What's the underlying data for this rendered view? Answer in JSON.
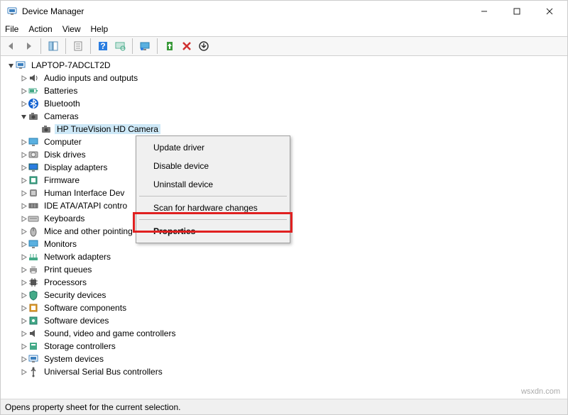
{
  "window": {
    "title": "Device Manager"
  },
  "menubar": [
    "File",
    "Action",
    "View",
    "Help"
  ],
  "toolbar_icons": [
    "nav-back",
    "nav-forward",
    "show-hide-tree",
    "properties",
    "help",
    "scan-hardware",
    "monitor",
    "update-driver",
    "uninstall",
    "action-dropdown"
  ],
  "tree": {
    "root": {
      "label": "LAPTOP-7ADCLT2D",
      "expanded": true
    },
    "items": [
      {
        "label": "Audio inputs and outputs",
        "icon": "audio-icon"
      },
      {
        "label": "Batteries",
        "icon": "battery-icon"
      },
      {
        "label": "Bluetooth",
        "icon": "bluetooth-icon"
      },
      {
        "label": "Cameras",
        "icon": "camera-icon",
        "expanded": true,
        "children": [
          {
            "label": "HP TrueVision HD Camera",
            "icon": "camera-icon",
            "selected": true
          }
        ]
      },
      {
        "label": "Computer",
        "icon": "computer-icon"
      },
      {
        "label": "Disk drives",
        "icon": "disk-icon"
      },
      {
        "label": "Display adapters",
        "icon": "display-icon"
      },
      {
        "label": "Firmware",
        "icon": "firmware-icon"
      },
      {
        "label": "Human Interface Dev",
        "icon": "hid-icon"
      },
      {
        "label": "IDE ATA/ATAPI contro",
        "icon": "ide-icon"
      },
      {
        "label": "Keyboards",
        "icon": "keyboard-icon"
      },
      {
        "label": "Mice and other pointing devices",
        "icon": "mouse-icon"
      },
      {
        "label": "Monitors",
        "icon": "monitor-icon"
      },
      {
        "label": "Network adapters",
        "icon": "network-icon"
      },
      {
        "label": "Print queues",
        "icon": "printer-icon"
      },
      {
        "label": "Processors",
        "icon": "processor-icon"
      },
      {
        "label": "Security devices",
        "icon": "security-icon"
      },
      {
        "label": "Software components",
        "icon": "softcomp-icon"
      },
      {
        "label": "Software devices",
        "icon": "softdev-icon"
      },
      {
        "label": "Sound, video and game controllers",
        "icon": "sound-icon"
      },
      {
        "label": "Storage controllers",
        "icon": "storage-icon"
      },
      {
        "label": "System devices",
        "icon": "system-icon"
      },
      {
        "label": "Universal Serial Bus controllers",
        "icon": "usb-icon"
      }
    ]
  },
  "context_menu": {
    "items": [
      {
        "label": "Update driver",
        "sep_after": false
      },
      {
        "label": "Disable device",
        "sep_after": false
      },
      {
        "label": "Uninstall device",
        "sep_after": true
      },
      {
        "label": "Scan for hardware changes",
        "sep_after": true
      },
      {
        "label": "Properties",
        "highlight": true
      }
    ]
  },
  "statusbar": {
    "text": "Opens property sheet for the current selection."
  },
  "watermark": "wsxdn.com"
}
